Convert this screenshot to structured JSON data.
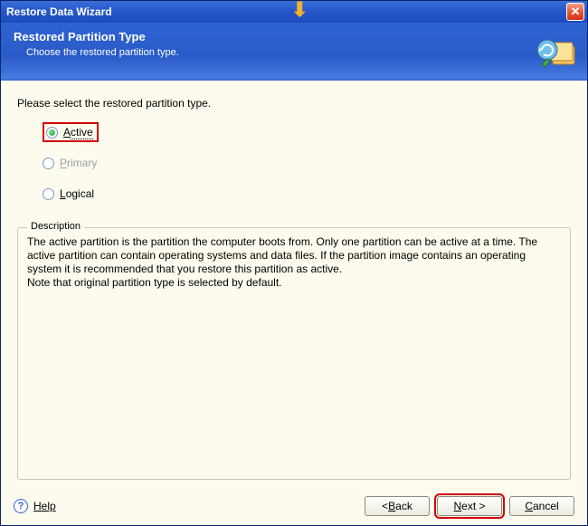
{
  "window": {
    "title": "Restore Data Wizard"
  },
  "header": {
    "heading": "Restored Partition Type",
    "sub": "Choose the restored partition type."
  },
  "content": {
    "prompt": "Please select the restored partition type.",
    "options": {
      "active": "Active",
      "primary": "Primary",
      "logical": "Logical"
    },
    "description_legend": "Description",
    "description_text": "The active partition is the partition the computer boots from. Only one partition can be active at a time. The active partition can contain operating systems and data files. If the partition image contains an operating system it is recommended that you restore this partition as active.\nNote that original partition type is selected by default."
  },
  "footer": {
    "help": "Help",
    "back": "Back",
    "next": "Next",
    "cancel": "Cancel"
  }
}
